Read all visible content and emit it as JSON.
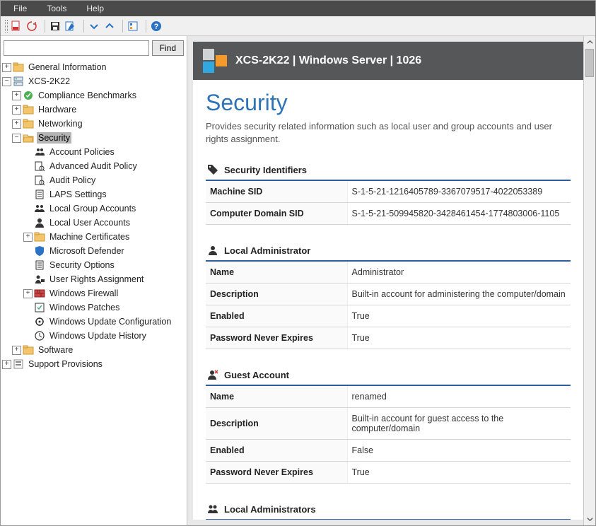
{
  "menu": {
    "file": "File",
    "tools": "Tools",
    "help": "Help"
  },
  "find": {
    "placeholder": "",
    "button": "Find"
  },
  "tree": {
    "general_info": "General Information",
    "host": "XCS-2K22",
    "compliance": "Compliance Benchmarks",
    "hardware": "Hardware",
    "networking": "Networking",
    "security": "Security",
    "sec_children": {
      "account_policies": "Account Policies",
      "adv_audit": "Advanced Audit Policy",
      "audit_policy": "Audit Policy",
      "laps": "LAPS Settings",
      "local_group": "Local Group Accounts",
      "local_user": "Local User Accounts",
      "machine_certs": "Machine Certificates",
      "defender": "Microsoft Defender",
      "sec_options": "Security Options",
      "user_rights": "User Rights Assignment",
      "firewall": "Windows Firewall",
      "patches": "Windows Patches",
      "wu_config": "Windows Update Configuration",
      "wu_history": "Windows Update History"
    },
    "software": "Software",
    "support": "Support Provisions"
  },
  "header": {
    "breadcrumb": "XCS-2K22 | Windows Server | 1026"
  },
  "page": {
    "title": "Security",
    "desc": "Provides security related information such as local user and group accounts and user rights assignment."
  },
  "sections": {
    "sids": {
      "title": "Security Identifiers",
      "rows": [
        {
          "k": "Machine SID",
          "v": "S-1-5-21-1216405789-3367079517-4022053389"
        },
        {
          "k": "Computer Domain SID",
          "v": "S-1-5-21-509945820-3428461454-1774803006-1105"
        }
      ]
    },
    "local_admin": {
      "title": "Local Administrator",
      "rows": [
        {
          "k": "Name",
          "v": "Administrator"
        },
        {
          "k": "Description",
          "v": "Built-in account for administering the computer/domain"
        },
        {
          "k": "Enabled",
          "v": "True"
        },
        {
          "k": "Password Never Expires",
          "v": "True"
        }
      ]
    },
    "guest": {
      "title": "Guest Account",
      "rows": [
        {
          "k": "Name",
          "v": "renamed"
        },
        {
          "k": "Description",
          "v": "Built-in account for guest access to the computer/domain"
        },
        {
          "k": "Enabled",
          "v": "False"
        },
        {
          "k": "Password Never Expires",
          "v": "True"
        }
      ]
    },
    "local_admins": {
      "title": "Local Administrators"
    }
  }
}
